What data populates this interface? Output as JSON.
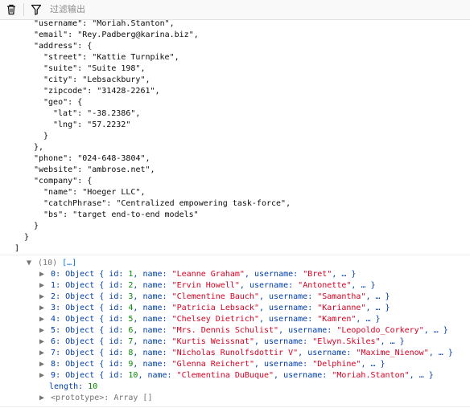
{
  "toolbar": {
    "trash_icon": "trash-icon",
    "filter_icon": "funnel-icon",
    "filter_placeholder": "过滤输出"
  },
  "previous_output": [
    {
      "indent": 3,
      "key": "username",
      "value": "Moriah.Stanton",
      "trail": ","
    },
    {
      "indent": 3,
      "key": "email",
      "value": "Rey.Padberg@karina.biz",
      "trail": ","
    },
    {
      "indent": 3,
      "key": "address",
      "open": "{"
    },
    {
      "indent": 4,
      "key": "street",
      "value": "Kattie Turnpike",
      "trail": ","
    },
    {
      "indent": 4,
      "key": "suite",
      "value": "Suite 198",
      "trail": ","
    },
    {
      "indent": 4,
      "key": "city",
      "value": "Lebsackbury",
      "trail": ","
    },
    {
      "indent": 4,
      "key": "zipcode",
      "value": "31428-2261",
      "trail": ","
    },
    {
      "indent": 4,
      "key": "geo",
      "open": "{"
    },
    {
      "indent": 5,
      "key": "lat",
      "value": "-38.2386",
      "trail": ","
    },
    {
      "indent": 5,
      "key": "lng",
      "value": "57.2232"
    },
    {
      "indent": 4,
      "raw": "}"
    },
    {
      "indent": 3,
      "raw": "},"
    },
    {
      "indent": 3,
      "key": "phone",
      "value": "024-648-3804",
      "trail": ","
    },
    {
      "indent": 3,
      "key": "website",
      "value": "ambrose.net",
      "trail": ","
    },
    {
      "indent": 3,
      "key": "company",
      "open": "{"
    },
    {
      "indent": 4,
      "key": "name",
      "value": "Hoeger LLC",
      "trail": ","
    },
    {
      "indent": 4,
      "key": "catchPhrase",
      "value": "Centralized empowering task-force",
      "trail": ","
    },
    {
      "indent": 4,
      "key": "bs",
      "value": "target end-to-end models"
    },
    {
      "indent": 3,
      "raw": "}"
    },
    {
      "indent": 2,
      "raw": "}"
    },
    {
      "indent": 1,
      "raw": "]"
    }
  ],
  "array_log": {
    "count_label": "(10)",
    "preview": "[…]",
    "items": [
      {
        "index": "0",
        "id": "1",
        "name": "Leanne Graham",
        "username": "Bret"
      },
      {
        "index": "1",
        "id": "2",
        "name": "Ervin Howell",
        "username": "Antonette"
      },
      {
        "index": "2",
        "id": "3",
        "name": "Clementine Bauch",
        "username": "Samantha"
      },
      {
        "index": "3",
        "id": "4",
        "name": "Patricia Lebsack",
        "username": "Karianne"
      },
      {
        "index": "4",
        "id": "5",
        "name": "Chelsey Dietrich",
        "username": "Kamren"
      },
      {
        "index": "5",
        "id": "6",
        "name": "Mrs. Dennis Schulist",
        "username": "Leopoldo_Corkery"
      },
      {
        "index": "6",
        "id": "7",
        "name": "Kurtis Weissnat",
        "username": "Elwyn.Skiles"
      },
      {
        "index": "7",
        "id": "8",
        "name": "Nicholas Runolfsdottir V",
        "username": "Maxime_Nienow"
      },
      {
        "index": "8",
        "id": "9",
        "name": "Glenna Reichert",
        "username": "Delphine"
      },
      {
        "index": "9",
        "id": "10",
        "name": "Clementina DuBuque",
        "username": "Moriah.Stanton"
      }
    ],
    "length_key": "length",
    "length_value": "10",
    "prototype_key": "<prototype>",
    "prototype_value": "Array []"
  }
}
